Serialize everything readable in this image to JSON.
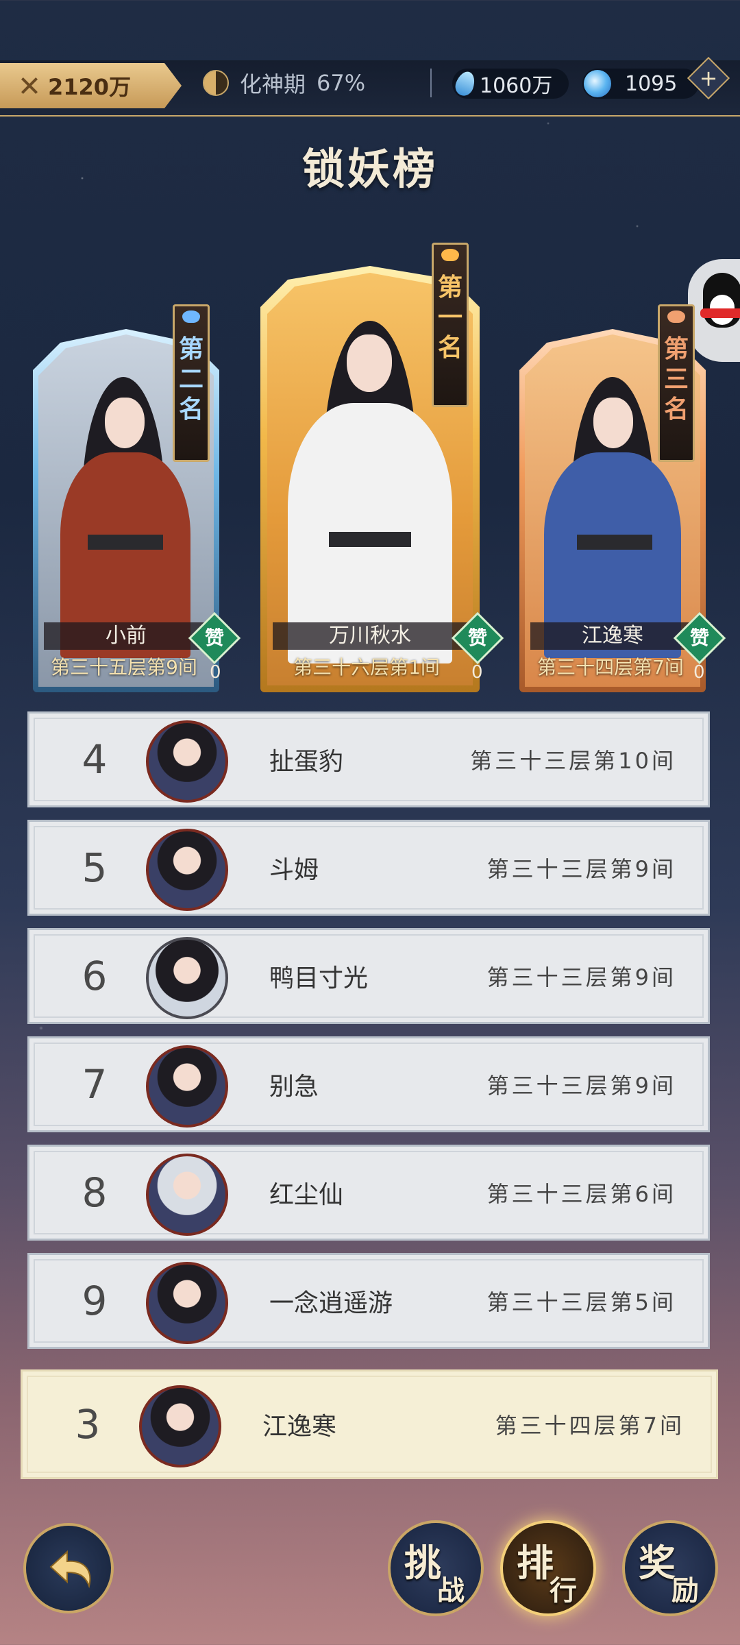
{
  "top_bar": {
    "power": "2120万",
    "realm": "化神期",
    "realm_progress": "67%",
    "spirit_stones": "1060万",
    "jade": "1095"
  },
  "title": "锁妖榜",
  "podium": [
    {
      "rank_label": [
        "第",
        "二",
        "名"
      ],
      "name": "小前",
      "floor": "第三十五层第9间",
      "praise_label": "赞",
      "praise_count": "0",
      "robe_color": "#9a3a26",
      "frame_color": "#8fd2ff"
    },
    {
      "rank_label": [
        "第",
        "一",
        "名"
      ],
      "name": "万川秋水",
      "floor": "第三十六层第1间",
      "praise_label": "赞",
      "praise_count": "0",
      "robe_color": "#f2f2f2",
      "frame_color": "#ffcf5a"
    },
    {
      "rank_label": [
        "第",
        "三",
        "名"
      ],
      "name": "江逸寒",
      "floor": "第三十四层第7间",
      "praise_label": "赞",
      "praise_count": "0",
      "robe_color": "#3f5ea8",
      "frame_color": "#ff9b5a"
    }
  ],
  "ranking": [
    {
      "rank": "4",
      "name": "扯蛋豹",
      "floor": "第三十三层第10间"
    },
    {
      "rank": "5",
      "name": "斗姆",
      "floor": "第三十三层第9间"
    },
    {
      "rank": "6",
      "name": "鸭目寸光",
      "floor": "第三十三层第9间"
    },
    {
      "rank": "7",
      "name": "别急",
      "floor": "第三十三层第9间"
    },
    {
      "rank": "8",
      "name": "红尘仙",
      "floor": "第三十三层第6间"
    },
    {
      "rank": "9",
      "name": "一念逍遥游",
      "floor": "第三十三层第5间"
    }
  ],
  "my_rank": {
    "rank": "3",
    "name": "江逸寒",
    "floor": "第三十四层第7间"
  },
  "bottom_buttons": {
    "challenge": [
      "挑",
      "战"
    ],
    "rank": [
      "排",
      "行"
    ],
    "reward": [
      "奖",
      "励"
    ]
  },
  "colors": {
    "gold": "#c9a86a",
    "praise": "#1f8a5a"
  }
}
